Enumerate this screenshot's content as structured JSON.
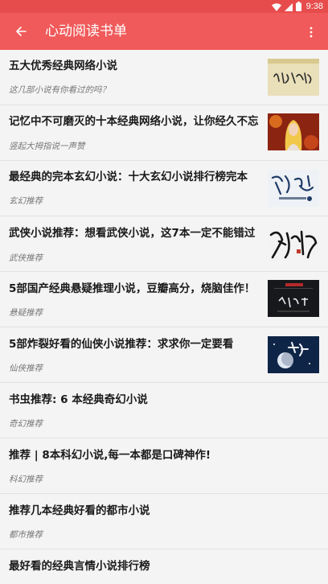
{
  "status_bar": {
    "time": "9:38"
  },
  "app_bar": {
    "title": "心动阅读书单"
  },
  "items": [
    {
      "title": "五大优秀经典网络小说",
      "subtitle": "这几部小说有你看过的吗？",
      "thumb": "calligraphy-scroll-image"
    },
    {
      "title": "记忆中不可磨灭的十本经典网络小说，让你经久不忘",
      "subtitle": "竖起大拇指说一声赞",
      "thumb": "golden-haired-character-image"
    },
    {
      "title": "最经典的完本玄幻小说：十大玄幻小说排行榜完本",
      "subtitle": "玄幻推荐",
      "thumb": "doupo-cangqiong-cover-image"
    },
    {
      "title": "武侠小说推荐：想看武侠小说，这7本一定不能错过",
      "subtitle": "武侠推荐",
      "thumb": "xiao-ao-jiang-hu-calligraphy-image"
    },
    {
      "title": "5部国产经典悬疑推理小说，豆瓣高分，烧脑佳作！",
      "subtitle": "悬疑推荐",
      "thumb": "dark-mystery-cover-image"
    },
    {
      "title": "5部炸裂好看的仙侠小说推荐：求求你一定要看",
      "subtitle": "仙侠推荐",
      "thumb": "xianxia-moon-cover-image"
    },
    {
      "title": "书虫推荐: 6 本经典奇幻小说",
      "subtitle": "奇幻推荐",
      "thumb": null
    },
    {
      "title": "推荐 | 8本科幻小说,每一本都是口碑神作!",
      "subtitle": "科幻推荐",
      "thumb": null
    },
    {
      "title": "推荐几本经典好看的都市小说",
      "subtitle": "都市推荐",
      "thumb": null
    },
    {
      "title": "最好看的经典言情小说排行榜",
      "subtitle": "",
      "thumb": null
    }
  ]
}
